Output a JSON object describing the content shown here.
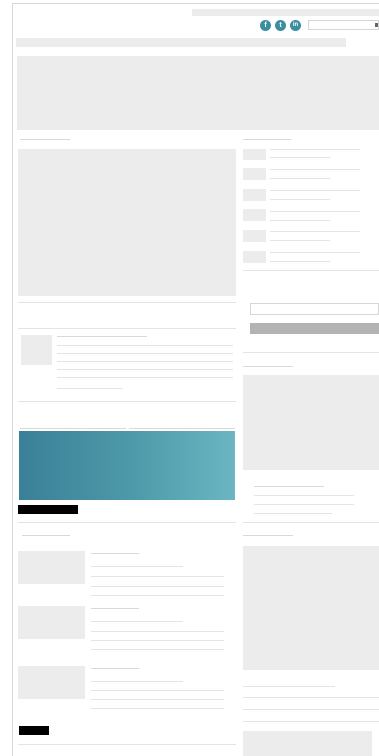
{
  "header": {
    "social": [
      {
        "icon": "facebook-icon",
        "glyph": "f"
      },
      {
        "icon": "twitter-icon",
        "glyph": "t"
      },
      {
        "icon": "linkedin-icon",
        "glyph": "in"
      }
    ],
    "search": {
      "placeholder": ""
    }
  },
  "colors": {
    "accent": "#3a8ea0",
    "banner_start": "#3a8098",
    "banner_end": "#6bb6c2",
    "placeholder": "#ececec",
    "button": "#b3b3b3"
  }
}
